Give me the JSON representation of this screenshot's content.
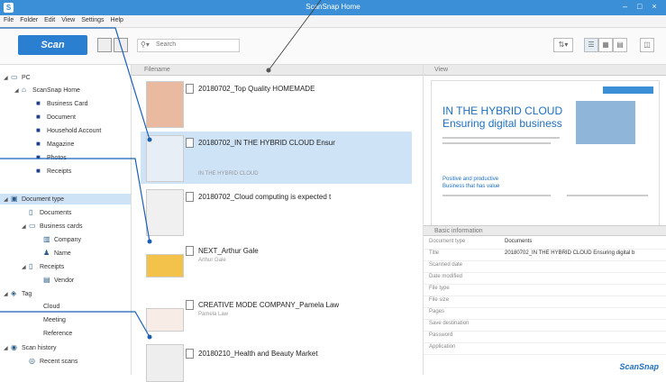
{
  "window": {
    "title": "ScanSnap Home"
  },
  "menu": [
    "File",
    "Folder",
    "Edit",
    "View",
    "Settings",
    "Help"
  ],
  "toolbar": {
    "scan_label": "Scan",
    "search_placeholder": "Search"
  },
  "sidebar": {
    "pc_label": "PC",
    "home_label": "ScanSnap Home",
    "folders": [
      "Business Card",
      "Document",
      "Household Account",
      "Magazine",
      "Photos",
      "Receipts"
    ],
    "doc_type_label": "Document type",
    "doc_types": [
      {
        "label": "Documents"
      },
      {
        "label": "Business cards"
      },
      {
        "label": "Company"
      },
      {
        "label": "Name"
      },
      {
        "label": "Receipts"
      },
      {
        "label": "Vendor"
      }
    ],
    "tag_label": "Tag",
    "tags": [
      "Cloud",
      "Meeting",
      "Reference"
    ],
    "history_label": "Scan history",
    "recent_label": "Recent scans"
  },
  "list": {
    "header": "Filename",
    "rows": [
      {
        "title": "20180702_Top Quality HOMEMADE"
      },
      {
        "title": "20180702_IN THE HYBRID CLOUD Ensur",
        "sub": "IN THE HYBRID CLOUD"
      },
      {
        "title": "20180702_Cloud computing is expected t"
      },
      {
        "title": "NEXT_Arthur Gale",
        "sub": "Arthur Gale"
      },
      {
        "title": "CREATIVE MODE COMPANY_Pamela Law",
        "sub": "Pamela Law"
      },
      {
        "title": "20180210_Health and Beauty Market"
      }
    ]
  },
  "viewer": {
    "header": "View",
    "heading1": "IN THE HYBRID CLOUD",
    "heading2": "Ensuring digital business",
    "sub1": "Positive and productive",
    "sub2": "Business that has value"
  },
  "info": {
    "header": "Basic information",
    "rows": [
      {
        "label": "Document type",
        "value": "Documents"
      },
      {
        "label": "Title",
        "value": "20180702_IN THE HYBRID CLOUD Ensuring digital b"
      },
      {
        "label": "Scanned date",
        "value": ""
      },
      {
        "label": "Date modified",
        "value": ""
      },
      {
        "label": "File type",
        "value": ""
      },
      {
        "label": "File size",
        "value": ""
      },
      {
        "label": "Pages",
        "value": ""
      },
      {
        "label": "Save destination",
        "value": ""
      },
      {
        "label": "Password",
        "value": ""
      },
      {
        "label": "Application",
        "value": ""
      }
    ]
  },
  "brand": "ScanSnap",
  "colors": {
    "accent": "#2a7fd1",
    "titlebar": "#3a8fd6",
    "selection": "#cfe3f7"
  }
}
